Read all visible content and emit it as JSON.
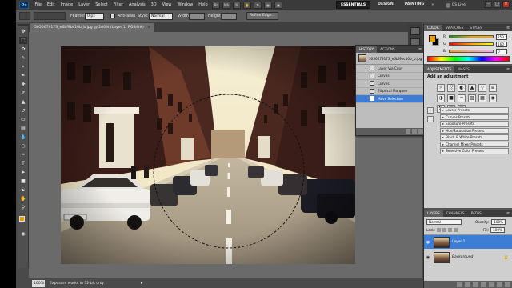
{
  "app": {
    "logo": "Ps",
    "menus": [
      "File",
      "Edit",
      "Image",
      "Layer",
      "Select",
      "Filter",
      "Analysis",
      "3D",
      "View",
      "Window",
      "Help"
    ],
    "workspaces": [
      "ESSENTIALS",
      "DESIGN",
      "PAINTING"
    ],
    "active_workspace": "ESSENTIALS",
    "more": "»",
    "cslive_label": "CS Live",
    "window_controls": [
      "–",
      "□",
      "✕"
    ]
  },
  "options": {
    "feather_label": "Feather:",
    "feather_value": "0 px",
    "antialias_label": "Anti-alias",
    "style_label": "Style:",
    "style_value": "Normal",
    "width_label": "Width:",
    "height_label": "Height:",
    "refine_edge_label": "Refine Edge..."
  },
  "document": {
    "tab_title": "5050679173_e6bf9bc10b_b.jpg @ 100% (Layer 1, RGB/8#)",
    "close": "×",
    "zoom": "100%",
    "status_text": "Exposure works in 32-bit only",
    "status_arrow": "▸"
  },
  "history": {
    "tabs": [
      "HISTORY",
      "ACTIONS"
    ],
    "menu": "≡",
    "snapshot_label": "5050679173_e6bf9bc10b_b.jpg",
    "steps": [
      "Layer Via Copy",
      "Curves",
      "Curves",
      "Elliptical Marquee",
      "Move Selection"
    ],
    "active_step": 4
  },
  "color_panel": {
    "tabs": [
      "COLOR",
      "SWATCHES",
      "STYLES"
    ],
    "channels": [
      {
        "name": "R",
        "value": "253",
        "gradient": "linear-gradient(to right,#00a000,#f0a000,#ffa000)"
      },
      {
        "name": "G",
        "value": "160",
        "gradient": "linear-gradient(to right,#fd0000,#fda000,#fdff00)"
      },
      {
        "name": "B",
        "value": "0",
        "gradient": "linear-gradient(to right,#fda000,#fda0ff)"
      }
    ],
    "foreground": "#f0a000",
    "background": "#000000"
  },
  "adjustments": {
    "tabs": [
      "ADJUSTMENTS",
      "MASKS"
    ],
    "title": "Add an adjustment",
    "icons": [
      "☼",
      "░",
      "◐",
      "▲",
      "▽",
      "≡",
      "◑",
      "■",
      "≈",
      "▨",
      "▦",
      "◉",
      "⚒",
      "▣",
      "▤"
    ],
    "presets": [
      "Levels Presets",
      "Curves Presets",
      "Exposure Presets",
      "Hue/Saturation Presets",
      "Black & White Presets",
      "Channel Mixer Presets",
      "Selective Color Presets"
    ]
  },
  "layers": {
    "tabs": [
      "LAYERS",
      "CHANNELS",
      "PATHS"
    ],
    "blend_mode": "Normal",
    "opacity_label": "Opacity:",
    "opacity_value": "100%",
    "lock_label": "Lock:",
    "fill_label": "Fill:",
    "fill_value": "100%",
    "items": [
      {
        "name": "Layer 1",
        "active": true
      },
      {
        "name": "Background",
        "active": false
      }
    ]
  }
}
